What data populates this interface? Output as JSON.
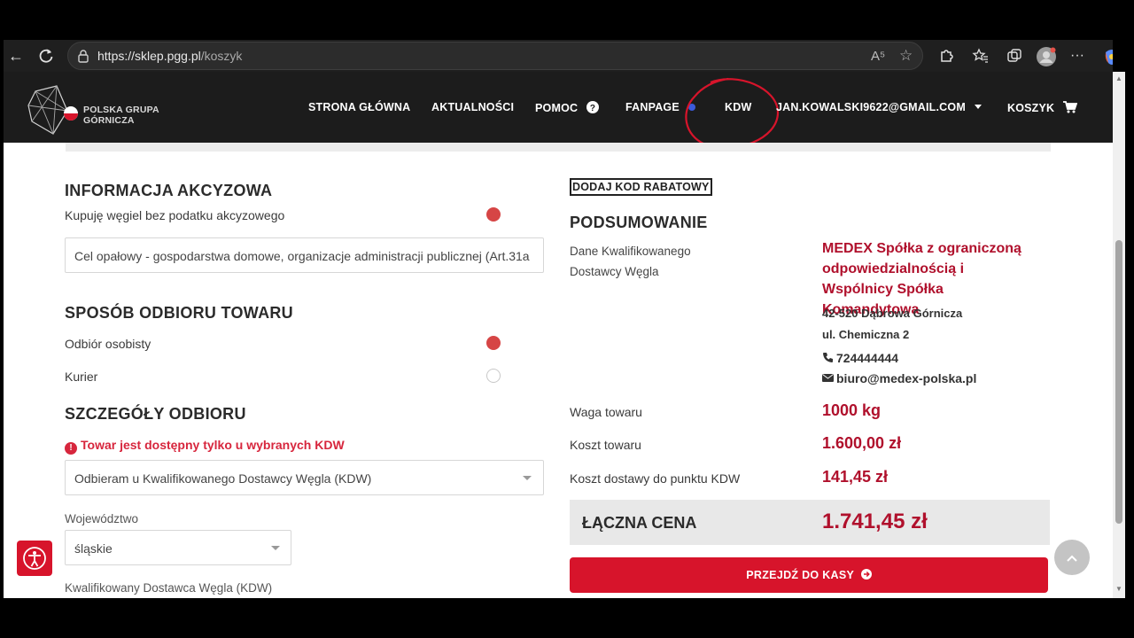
{
  "browser": {
    "url_host": "https://sklep.pgg.pl",
    "url_path": "/koszyk",
    "reader_label": "A⁵"
  },
  "header": {
    "logo_line1": "POLSKA GRUPA",
    "logo_line2": "GÓRNICZA",
    "menu": {
      "home": "STRONA GŁÓWNA",
      "news": "AKTUALNOŚCI",
      "help": "POMOC",
      "fanpage": "FANPAGE",
      "kdw": "KDW",
      "account": "JAN.KOWALSKI9622@GMAIL.COM",
      "cart": "KOSZYK"
    }
  },
  "left": {
    "excise_title": "INFORMACJA AKCYZOWA",
    "excise_option": "Kupuję węgiel bez podatku akcyzowego",
    "excise_purpose": "Cel opałowy - gospodarstwa domowe, organizacje administracji publicznej (Art.31a",
    "pickup_title": "SPOSÓB ODBIORU TOWARU",
    "pickup_personal": "Odbiór osobisty",
    "pickup_courier": "Kurier",
    "details_title": "SZCZEGÓŁY ODBIORU",
    "availability_warning": "Towar jest dostępny tylko u wybranych KDW",
    "pickup_select": "Odbieram u Kwalifikowanego Dostawcy Węgla (KDW)",
    "voivodeship_label": "Województwo",
    "voivodeship_value": "śląskie",
    "kdw_label": "Kwalifikowany Dostawca Węgla (KDW)"
  },
  "right": {
    "discount_button": "DODAJ KOD RABATOWY",
    "summary_title": "PODSUMOWANIE",
    "dealer_label_1": "Dane Kwalifikowanego",
    "dealer_label_2": "Dostawcy Węgla",
    "dealer_name": "MEDEX Spółka z ograniczoną odpowiedzialnością i Wspólnicy Spółka Komandytowa",
    "dealer_city": "42-520 Dąbrowa Górnicza",
    "dealer_street": "ul. Chemiczna 2",
    "dealer_phone": "724444444",
    "dealer_email": "biuro@medex-polska.pl",
    "weight_label": "Waga towaru",
    "weight_value": "1000 kg",
    "cost_label": "Koszt towaru",
    "cost_value": "1.600,00 zł",
    "delivery_label": "Koszt dostawy do punktu KDW",
    "delivery_value": "141,45 zł",
    "total_label": "ŁĄCZNA CENA",
    "total_value": "1.741,45 zł",
    "checkout_button": "PRZEJDŹ DO KASY"
  }
}
